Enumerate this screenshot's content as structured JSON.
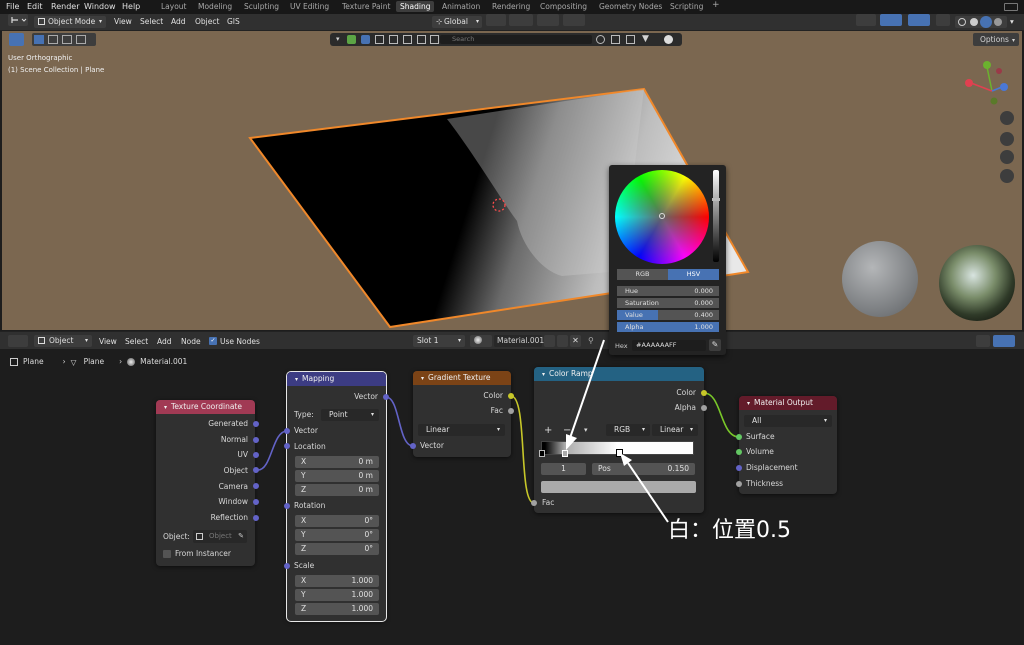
{
  "topbar": {
    "menus": [
      "File",
      "Edit",
      "Render",
      "Window",
      "Help"
    ],
    "workspaces": [
      "Layout",
      "Modeling",
      "Sculpting",
      "UV Editing",
      "Texture Paint",
      "Shading",
      "Animation",
      "Rendering",
      "Compositing",
      "Geometry Nodes",
      "Scripting",
      "+"
    ],
    "active_workspace": "Shading"
  },
  "vp_header": {
    "mode": "Object Mode",
    "menus": [
      "View",
      "Select",
      "Add",
      "Object",
      "GIS"
    ],
    "orientation": "Global",
    "options": "Options"
  },
  "viewport": {
    "view_name": "User Orthographic",
    "collection": "(1) Scene Collection | Plane",
    "search_placeholder": "Search",
    "bg_color": "#7b6750",
    "selection_color": "#f0882a"
  },
  "ne_header": {
    "type": "Object",
    "menus": [
      "View",
      "Select",
      "Add",
      "Node"
    ],
    "use_nodes": "Use Nodes",
    "slot": "Slot 1",
    "material": "Material.001"
  },
  "breadcrumb": [
    "Plane",
    "Plane",
    "Material.001"
  ],
  "nodes": {
    "tex_coord": {
      "title": "Texture Coordinate",
      "outputs": [
        "Generated",
        "Normal",
        "UV",
        "Object",
        "Camera",
        "Window",
        "Reflection"
      ],
      "object_label": "Object:",
      "object_placeholder": "Object",
      "from_instancer": "From Instancer"
    },
    "mapping": {
      "title": "Mapping",
      "output": "Vector",
      "type_label": "Type:",
      "type_value": "Point",
      "input_vector": "Vector",
      "location": "Location",
      "loc": [
        {
          "axis": "X",
          "value": "0 m"
        },
        {
          "axis": "Y",
          "value": "0 m"
        },
        {
          "axis": "Z",
          "value": "0 m"
        }
      ],
      "rotation": "Rotation",
      "rot": [
        {
          "axis": "X",
          "value": "0°"
        },
        {
          "axis": "Y",
          "value": "0°"
        },
        {
          "axis": "Z",
          "value": "0°"
        }
      ],
      "scale": "Scale",
      "scl": [
        {
          "axis": "X",
          "value": "1.000"
        },
        {
          "axis": "Y",
          "value": "1.000"
        },
        {
          "axis": "Z",
          "value": "1.000"
        }
      ]
    },
    "gradient": {
      "title": "Gradient Texture",
      "outputs": [
        "Color",
        "Fac"
      ],
      "type": "Linear",
      "input": "Vector"
    },
    "color_ramp": {
      "title": "Color Ramp",
      "outputs": [
        "Color",
        "Alpha"
      ],
      "add": "+",
      "remove": "−",
      "color_mode": "RGB",
      "interpolation": "Linear",
      "index": "1",
      "pos_label": "Pos",
      "pos_value": "0.150",
      "input": "Fac"
    },
    "material_output": {
      "title": "Material Output",
      "target": "All",
      "inputs": [
        "Surface",
        "Volume",
        "Displacement",
        "Thickness"
      ]
    }
  },
  "picker": {
    "tabs": [
      "RGB",
      "HSV"
    ],
    "active_tab": "HSV",
    "fields": [
      {
        "label": "Hue",
        "value": "0.000"
      },
      {
        "label": "Saturation",
        "value": "0.000"
      },
      {
        "label": "Value",
        "value": "0.400"
      },
      {
        "label": "Alpha",
        "value": "1.000"
      }
    ],
    "hex_label": "Hex",
    "hex_value": "#AAAAAAFF"
  },
  "annotation": "白：位置0.5",
  "colors": {
    "tex_coord_header": "#a13a54",
    "mapping_header": "#3c3c83",
    "gradient_header": "#7b4316",
    "color_ramp_header": "#246283",
    "output_header": "#631b2a",
    "vector_socket": "#6363c7",
    "color_socket": "#c7c729",
    "float_socket": "#a1a1a1"
  }
}
